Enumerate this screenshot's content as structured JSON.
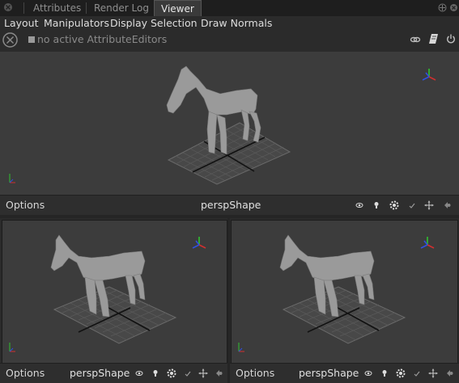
{
  "tabs": [
    {
      "label": "Attributes"
    },
    {
      "label": "Render Log"
    },
    {
      "label": "Viewer"
    }
  ],
  "menu": [
    "Layout",
    "Manipulators",
    "Display",
    "Selection",
    "Draw Normals"
  ],
  "attribute_editor": {
    "status": "no active AttributeEditors"
  },
  "viewports": [
    {
      "options_label": "Options",
      "camera": "perspShape"
    },
    {
      "options_label": "Options",
      "camera": "perspShape"
    },
    {
      "options_label": "Options",
      "camera": "perspShape"
    }
  ],
  "colors": {
    "axis_x": "#d03030",
    "axis_y": "#30c030",
    "axis_z": "#3050e0",
    "viewport_bg": "#3c3c3c"
  }
}
